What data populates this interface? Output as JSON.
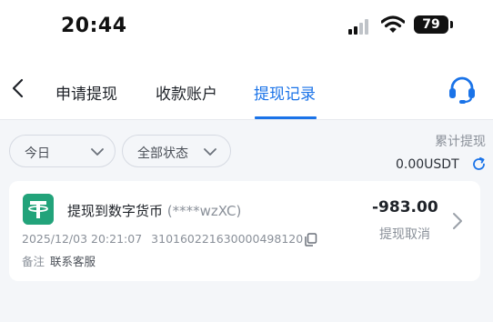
{
  "status_bar": {
    "time": "20:44",
    "battery": "79"
  },
  "nav": {
    "tabs": [
      {
        "label": "申请提现",
        "active": false
      },
      {
        "label": "收款账户",
        "active": false
      },
      {
        "label": "提现记录",
        "active": true
      }
    ],
    "icons": {
      "back": "chevron-left-icon",
      "support": "headset-icon"
    },
    "accent": "#1a73e8"
  },
  "filters": {
    "date_label": "今日",
    "status_label": "全部状态"
  },
  "summary": {
    "label": "累计提现",
    "amount": "0.00USDT"
  },
  "records": [
    {
      "title": "提现到数字货币",
      "address": "(****wzXC)",
      "amount": "-983.00",
      "status": "提现取消",
      "datetime": "2025/12/03 20:21:07",
      "order_no": "310160221630000498120",
      "note_label": "备注",
      "note_value": "联系客服",
      "icon": "tether-usdt-icon"
    }
  ]
}
